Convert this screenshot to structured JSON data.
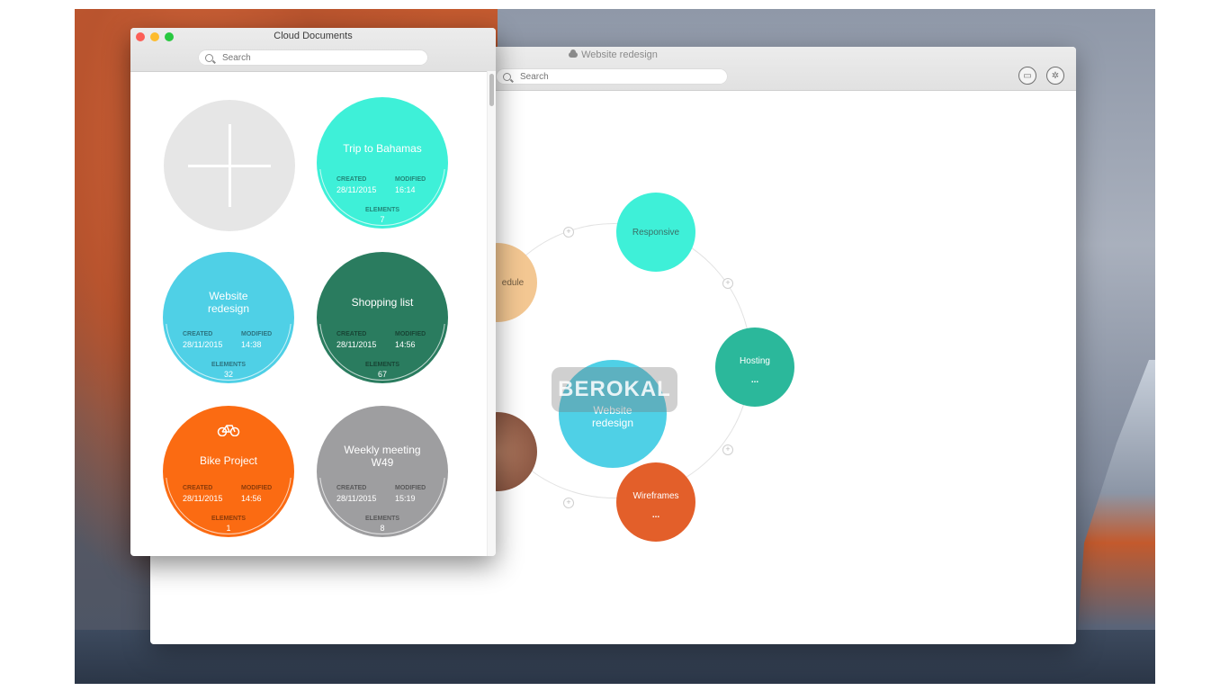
{
  "back_window": {
    "title": "Website redesign",
    "search_placeholder": "Search",
    "toolbar": {
      "chat_icon": "chat-icon",
      "settings_icon": "gear-icon"
    },
    "mindmap": {
      "center": "Website redesign",
      "nodes": [
        {
          "label": "Responsive",
          "color": "#3ef0d8"
        },
        {
          "label": "Hosting",
          "color": "#2bb89b",
          "more": "..."
        },
        {
          "label": "Wireframes",
          "color": "#e35f2a",
          "more": "..."
        },
        {
          "label": "edule",
          "color": "#f3c792"
        },
        {
          "label": "",
          "color": "#9a5d47"
        }
      ],
      "watermark": "BEROKAL"
    }
  },
  "front_window": {
    "title": "Cloud Documents",
    "search_placeholder": "Search",
    "documents": [
      {
        "name": "",
        "type": "new",
        "color": "#e6e6e6"
      },
      {
        "name": "Trip to Bahamas",
        "created_label": "CREATED",
        "created": "28/11/2015",
        "modified_label": "MODIFIED",
        "modified": "16:14",
        "elements_label": "ELEMENTS",
        "elements": "7",
        "color": "#3ef0d8"
      },
      {
        "name": "Website redesign",
        "created_label": "CREATED",
        "created": "28/11/2015",
        "modified_label": "MODIFIED",
        "modified": "14:38",
        "elements_label": "ELEMENTS",
        "elements": "32",
        "color": "#4fd0e6"
      },
      {
        "name": "Shopping list",
        "created_label": "CREATED",
        "created": "28/11/2015",
        "modified_label": "MODIFIED",
        "modified": "14:56",
        "elements_label": "ELEMENTS",
        "elements": "67",
        "color": "#2a7c5f"
      },
      {
        "name": "Bike Project",
        "created_label": "CREATED",
        "created": "28/11/2015",
        "modified_label": "MODIFIED",
        "modified": "14:56",
        "elements_label": "ELEMENTS",
        "elements": "1",
        "color": "#fb6b12"
      },
      {
        "name": "Weekly meeting W49",
        "created_label": "CREATED",
        "created": "28/11/2015",
        "modified_label": "MODIFIED",
        "modified": "15:19",
        "elements_label": "ELEMENTS",
        "elements": "8",
        "color": "#9e9ea0"
      }
    ]
  }
}
